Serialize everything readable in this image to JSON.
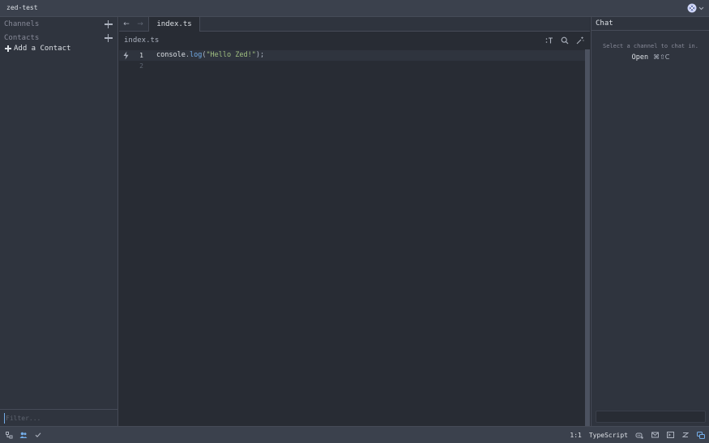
{
  "window": {
    "title": "zed-test"
  },
  "left_panel": {
    "channels_label": "Channels",
    "contacts_label": "Contacts",
    "add_contact_label": "Add a Contact",
    "filter_placeholder": "Filter..."
  },
  "tabs": [
    {
      "label": "index.ts",
      "active": true
    }
  ],
  "breadcrumb": "index.ts",
  "editor": {
    "lines": [
      {
        "number": "1",
        "active": true,
        "tokens": {
          "obj": "console",
          "dot": ".",
          "fn": "log",
          "open": "(",
          "str": "\"Hello Zed!\"",
          "close": ");"
        }
      },
      {
        "number": "2",
        "active": false
      }
    ]
  },
  "chat": {
    "title": "Chat",
    "hint": "Select a channel to chat in.",
    "open_label": "Open",
    "open_shortcut": "⌘⇧C"
  },
  "status_bar": {
    "cursor_position": "1:1",
    "language": "TypeScript"
  },
  "colors": {
    "accent": "#74ade8",
    "string": "#a1c181",
    "function": "#73ade9",
    "background": "#282c34",
    "panel": "#2f343e"
  },
  "icons": [
    "collab-avatar-icon",
    "chevron-down-icon",
    "plus-icon",
    "back-arrow-icon",
    "forward-arrow-icon",
    "symbol-outline-icon",
    "search-icon",
    "assistant-sparkle-icon",
    "run-bolt-icon",
    "project-panel-icon",
    "contacts-icon",
    "check-icon",
    "copilot-icon",
    "feedback-icon",
    "terminal-icon",
    "zed-icon",
    "chat-bubble-icon"
  ]
}
